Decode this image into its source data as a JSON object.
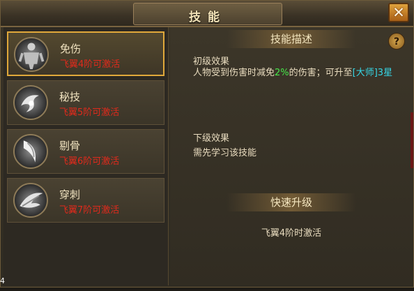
{
  "window": {
    "title": "技能",
    "close_glyph": "✕"
  },
  "skills": [
    {
      "name": "免伤",
      "condition": "飞翼4阶可激活",
      "icon": "armored-figure-icon",
      "selected": true
    },
    {
      "name": "秘技",
      "condition": "飞翼5阶可激活",
      "icon": "swirl-orb-icon",
      "selected": false
    },
    {
      "name": "剔骨",
      "condition": "飞翼6阶可激活",
      "icon": "blade-slash-icon",
      "selected": false
    },
    {
      "name": "穿刺",
      "condition": "飞翼7阶可激活",
      "icon": "pierce-wing-icon",
      "selected": false
    }
  ],
  "description": {
    "header": "技能描述",
    "help_glyph": "?",
    "primary_label": "初级效果",
    "primary_text_prefix": "人物受到伤害时减免",
    "primary_value": "2%",
    "primary_text_middle": "的伤害；可升至",
    "primary_rank": "[大师]3星",
    "next_label": "下级效果",
    "next_text": "需先学习该技能"
  },
  "quick_upgrade": {
    "header": "快速升级",
    "note": "飞翼4阶时激活"
  },
  "corner_text": "4",
  "colors": {
    "accent_gold": "#e0a83a",
    "condition_red": "#e02a1c",
    "value_green": "#46e84a",
    "rank_cyan": "#36d8e8"
  }
}
